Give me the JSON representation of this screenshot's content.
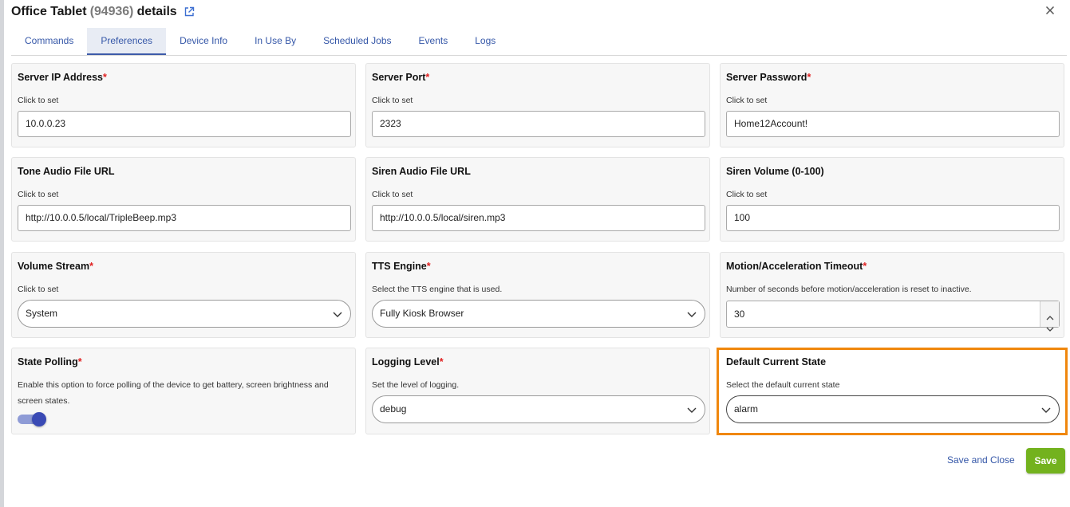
{
  "dialog": {
    "title_name": "Office Tablet",
    "title_id": "(94936)",
    "title_suffix": "details"
  },
  "tabs": [
    {
      "label": "Commands"
    },
    {
      "label": "Preferences",
      "active": true
    },
    {
      "label": "Device Info"
    },
    {
      "label": "In Use By"
    },
    {
      "label": "Scheduled Jobs"
    },
    {
      "label": "Events"
    },
    {
      "label": "Logs"
    }
  ],
  "prefs": {
    "server_ip": {
      "label": "Server IP Address",
      "required": "*",
      "desc": "Click to set",
      "value": "10.0.0.23"
    },
    "server_port": {
      "label": "Server Port",
      "required": "*",
      "desc": "Click to set",
      "value": "2323"
    },
    "server_password": {
      "label": "Server Password",
      "required": "*",
      "desc": "Click to set",
      "value": "Home12Account!"
    },
    "tone_url": {
      "label": "Tone Audio File URL",
      "desc": "Click to set",
      "value": "http://10.0.0.5/local/TripleBeep.mp3"
    },
    "siren_url": {
      "label": "Siren Audio File URL",
      "desc": "Click to set",
      "value": "http://10.0.0.5/local/siren.mp3"
    },
    "siren_volume": {
      "label": "Siren Volume (0-100)",
      "desc": "Click to set",
      "value": "100"
    },
    "volume_stream": {
      "label": "Volume Stream",
      "required": "*",
      "desc": "Click to set",
      "value": "System"
    },
    "tts_engine": {
      "label": "TTS Engine",
      "required": "*",
      "desc": "Select the TTS engine that is used.",
      "value": "Fully Kiosk Browser"
    },
    "motion_timeout": {
      "label": "Motion/Acceleration Timeout",
      "required": "*",
      "desc": "Number of seconds before motion/acceleration is reset to inactive.",
      "value": "30"
    },
    "state_polling": {
      "label": "State Polling",
      "required": "*",
      "desc": "Enable this option to force polling of the device to get battery, screen brightness and screen states.",
      "enabled": true
    },
    "logging_level": {
      "label": "Logging Level",
      "required": "*",
      "desc": "Set the level of logging.",
      "value": "debug"
    },
    "default_state": {
      "label": "Default Current State",
      "desc": "Select the default current state",
      "value": "alarm"
    }
  },
  "footer": {
    "save_close_label": "Save and Close",
    "save_label": "Save"
  },
  "colors": {
    "accent": "#3557a8",
    "save": "#73b21e",
    "highlight": "#f0870d",
    "required": "#e02020"
  }
}
